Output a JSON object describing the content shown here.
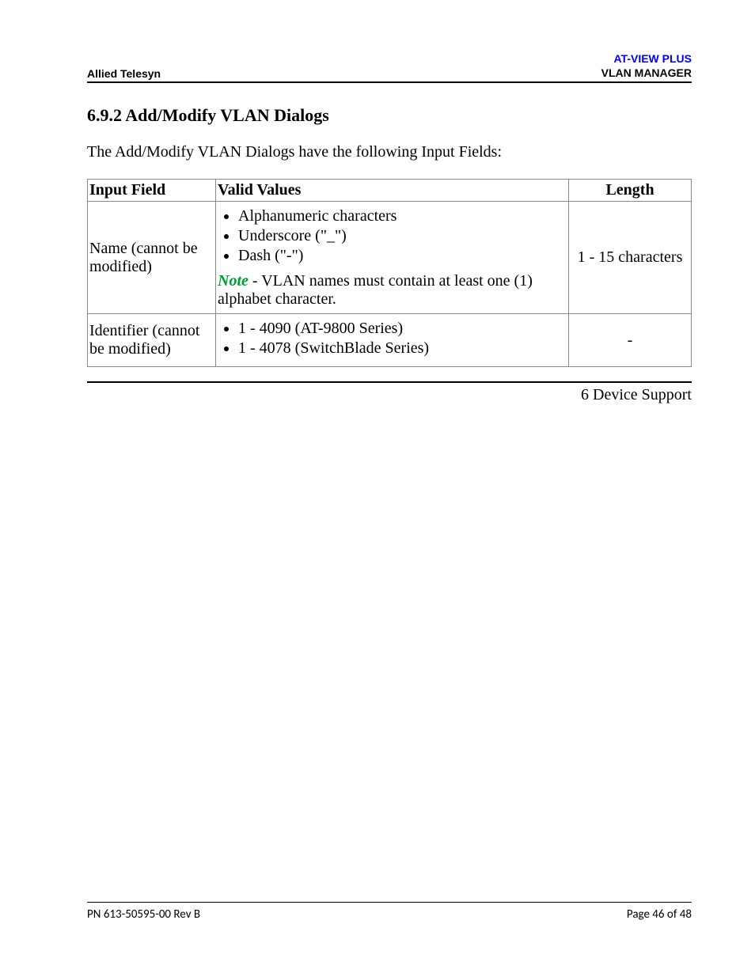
{
  "header": {
    "left": "Allied Telesyn",
    "right_line1": "AT-VIEW PLUS",
    "right_line2": "VLAN MANAGER"
  },
  "section": {
    "heading": "6.9.2 Add/Modify VLAN Dialogs",
    "intro": "The Add/Modify VLAN Dialogs have the following Input Fields:"
  },
  "table": {
    "headers": {
      "input_field": "Input Field",
      "valid_values": "Valid Values",
      "length": "Length"
    },
    "rows": [
      {
        "input_field": "Name (cannot be modified)",
        "valid_values_bullets": [
          "Alphanumeric characters",
          "Underscore (\"_\")",
          "Dash (\"-\")"
        ],
        "note_label": "Note",
        "note_text": " - VLAN names must contain at least one (1) alphabet character.",
        "length": "1 - 15 characters"
      },
      {
        "input_field": "Identifier (cannot be modified)",
        "valid_values_bullets": [
          "1 - 4090 (AT-9800 Series)",
          "1 - 4078 (SwitchBlade Series)"
        ],
        "note_label": "",
        "note_text": "",
        "length": "-"
      }
    ]
  },
  "section_footer": "6 Device Support",
  "footer": {
    "left": "PN 613-50595-00 Rev B",
    "right": "Page 46 of 48"
  }
}
